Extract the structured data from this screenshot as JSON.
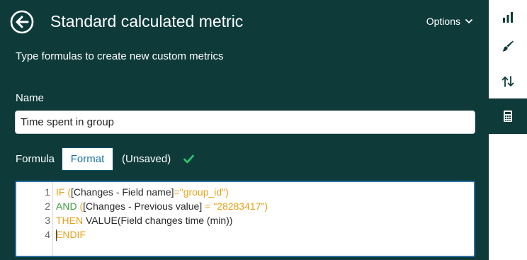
{
  "header": {
    "title": "Standard calculated metric",
    "options_label": "Options",
    "subtitle": "Type formulas to create new custom metrics"
  },
  "name_field": {
    "label": "Name",
    "value": "Time spent in group"
  },
  "formula": {
    "label": "Formula",
    "format_button": "Format",
    "status": "(Unsaved)"
  },
  "editor": {
    "lines": [
      {
        "number": "1",
        "parts": [
          {
            "text": "IF (",
            "style": "kw-orange"
          },
          {
            "text": "[Changes - Field name]",
            "style": ""
          },
          {
            "text": "=",
            "style": "kw-orange"
          },
          {
            "text": "\"group_id\"",
            "style": "str"
          },
          {
            "text": ")",
            "style": "kw-orange"
          }
        ]
      },
      {
        "number": "2",
        "parts": [
          {
            "text": "AND ",
            "style": "kw-green"
          },
          {
            "text": "(",
            "style": "kw-orange"
          },
          {
            "text": "[Changes - Previous value]",
            "style": ""
          },
          {
            "text": " = ",
            "style": "kw-orange"
          },
          {
            "text": "\"28283417\"",
            "style": "str"
          },
          {
            "text": ")",
            "style": "kw-orange"
          }
        ]
      },
      {
        "number": "3",
        "parts": [
          {
            "text": "THEN ",
            "style": "kw-orange"
          },
          {
            "text": "VALUE(Field changes time (min))",
            "style": ""
          }
        ]
      },
      {
        "number": "4",
        "parts": [
          {
            "text": "ENDIF",
            "style": "kw-orange"
          }
        ]
      }
    ]
  },
  "sidebar": {
    "items": [
      {
        "icon": "bar-chart-icon",
        "active": false
      },
      {
        "icon": "paintbrush-icon",
        "active": false
      },
      {
        "icon": "sort-arrows-icon",
        "active": false
      },
      {
        "icon": "calculator-icon",
        "active": true
      }
    ]
  },
  "colors": {
    "panel_bg": "#0e3b3a",
    "keyword_orange": "#e8a11a",
    "keyword_green": "#3d9a3d",
    "check_green": "#2ecc71",
    "editor_border": "#2d6fa0"
  }
}
